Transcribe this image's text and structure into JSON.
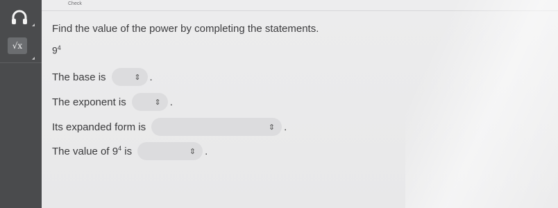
{
  "topbar": {
    "check_label": "Check"
  },
  "prompt": "Find the value of the power by completing the statements.",
  "expression": {
    "base": "9",
    "exponent": "4"
  },
  "rows": [
    {
      "label": "The base is",
      "end": "."
    },
    {
      "label": "The exponent is",
      "end": "."
    },
    {
      "label": "Its expanded form is",
      "end": "."
    },
    {
      "label_prefix": "The value of 9",
      "label_exp": "4",
      "label_suffix": " is",
      "end": "."
    }
  ],
  "icons": {
    "headphones": "headphones-icon",
    "sqrt": "sqrt-icon",
    "dropdown": "updown-chevron-icon"
  },
  "sidebar_tool_glyph": "√x",
  "colors": {
    "sidebar": "#4a4b4d",
    "background": "#e9e9ea",
    "select": "#dcdcde"
  }
}
